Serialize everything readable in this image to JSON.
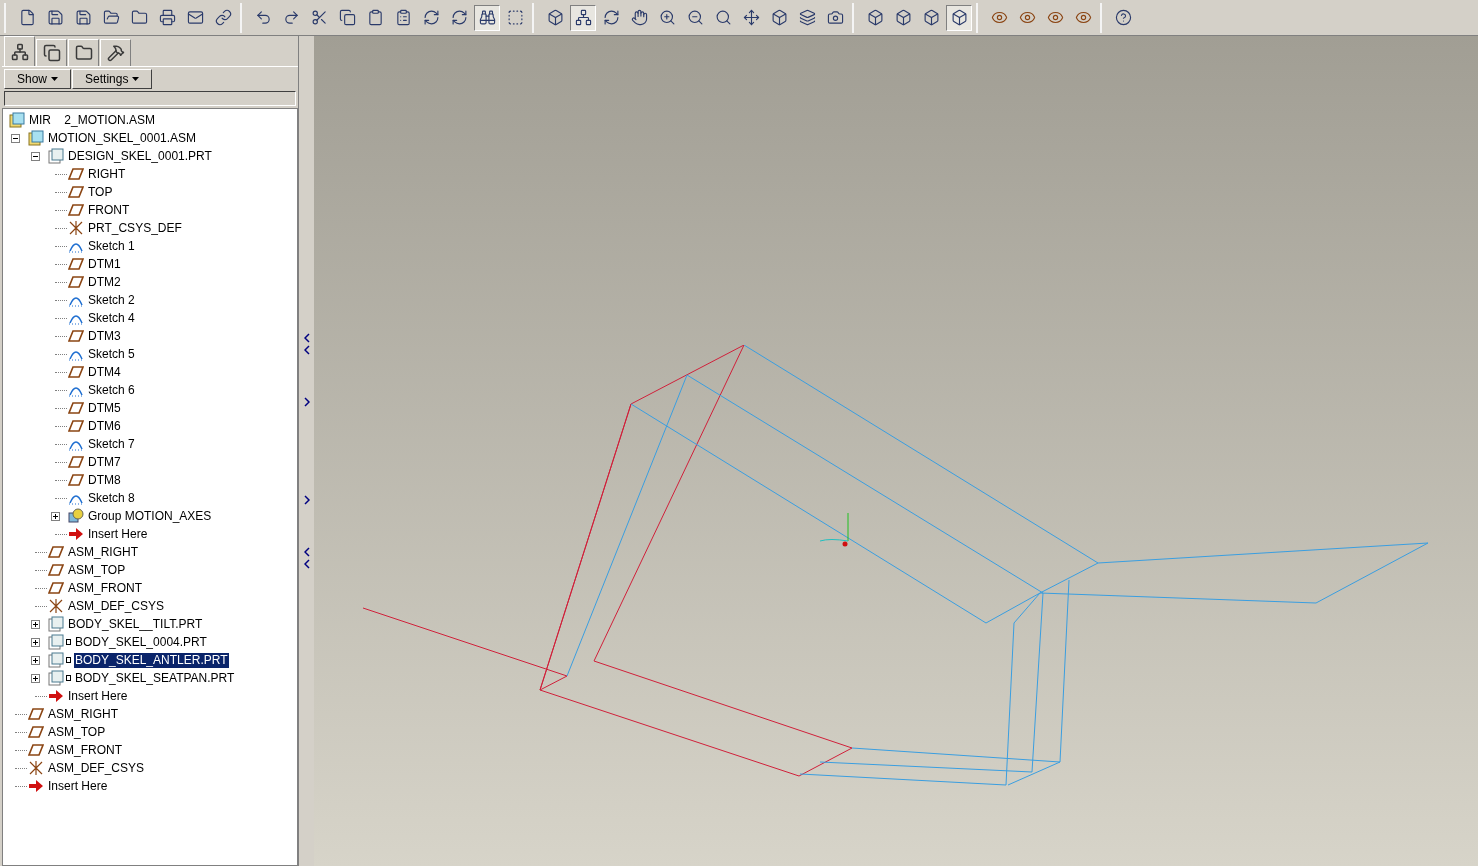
{
  "toolbar": {
    "groups": [
      {
        "buttons": [
          {
            "pressed": false
          },
          {
            "pressed": false
          },
          {
            "pressed": false
          },
          {
            "pressed": false
          },
          {
            "pressed": false
          },
          {
            "pressed": false
          },
          {
            "pressed": false
          },
          {
            "pressed": false
          }
        ]
      },
      {
        "buttons": [
          {
            "pressed": false
          },
          {
            "pressed": false
          },
          {
            "pressed": false
          },
          {
            "pressed": false
          },
          {
            "pressed": false
          },
          {
            "pressed": false
          },
          {
            "pressed": false
          },
          {
            "pressed": false
          },
          {
            "pressed": true
          },
          {
            "pressed": false
          }
        ]
      },
      {
        "buttons": [
          {
            "pressed": false
          },
          {
            "pressed": true
          },
          {
            "pressed": false
          },
          {
            "pressed": false
          },
          {
            "pressed": false
          },
          {
            "pressed": false
          },
          {
            "pressed": false
          },
          {
            "pressed": false
          },
          {
            "pressed": false
          },
          {
            "pressed": false
          },
          {
            "pressed": false
          }
        ]
      },
      {
        "buttons": [
          {
            "pressed": false
          },
          {
            "pressed": false
          },
          {
            "pressed": false
          },
          {
            "pressed": true
          }
        ]
      },
      {
        "buttons": [
          {
            "pressed": false
          },
          {
            "pressed": false
          },
          {
            "pressed": false
          },
          {
            "pressed": false
          }
        ]
      },
      {
        "buttons": [
          {
            "pressed": false
          }
        ]
      }
    ]
  },
  "panel_tabs": [
    {
      "selected": true
    },
    {
      "selected": false
    },
    {
      "selected": false
    },
    {
      "selected": false
    }
  ],
  "panel_menus": [
    "Show",
    "Settings"
  ],
  "tree": [
    {
      "kind": "asm",
      "label": "MIR    2_MOTION.ASM",
      "selected": false,
      "children": [
        {
          "kind": "asm",
          "label": "MOTION_SKEL_0001.ASM",
          "expanded": true,
          "selected": false,
          "children": [
            {
              "kind": "part",
              "label": "DESIGN_SKEL_0001.PRT",
              "expanded": true,
              "selected": false,
              "children": [
                {
                  "kind": "plane",
                  "label": "RIGHT",
                  "selected": false
                },
                {
                  "kind": "plane",
                  "label": "TOP",
                  "selected": false
                },
                {
                  "kind": "plane",
                  "label": "FRONT",
                  "selected": false
                },
                {
                  "kind": "csys",
                  "label": "PRT_CSYS_DEF",
                  "selected": false
                },
                {
                  "kind": "sketch",
                  "label": "Sketch 1",
                  "selected": false
                },
                {
                  "kind": "plane",
                  "label": "DTM1",
                  "selected": false
                },
                {
                  "kind": "plane",
                  "label": "DTM2",
                  "selected": false
                },
                {
                  "kind": "sketch",
                  "label": "Sketch 2",
                  "selected": false
                },
                {
                  "kind": "sketch",
                  "label": "Sketch 4",
                  "selected": false
                },
                {
                  "kind": "plane",
                  "label": "DTM3",
                  "selected": false
                },
                {
                  "kind": "sketch",
                  "label": "Sketch 5",
                  "selected": false
                },
                {
                  "kind": "plane",
                  "label": "DTM4",
                  "selected": false
                },
                {
                  "kind": "sketch",
                  "label": "Sketch 6",
                  "selected": false
                },
                {
                  "kind": "plane",
                  "label": "DTM5",
                  "selected": false
                },
                {
                  "kind": "plane",
                  "label": "DTM6",
                  "selected": false
                },
                {
                  "kind": "sketch",
                  "label": "Sketch 7",
                  "selected": false
                },
                {
                  "kind": "plane",
                  "label": "DTM7",
                  "selected": false
                },
                {
                  "kind": "plane",
                  "label": "DTM8",
                  "selected": false
                },
                {
                  "kind": "sketch",
                  "label": "Sketch 8",
                  "selected": false
                },
                {
                  "kind": "group",
                  "label": "Group MOTION_AXES",
                  "expanded": false,
                  "selected": false
                },
                {
                  "kind": "insert",
                  "label": "Insert Here",
                  "selected": false
                }
              ]
            },
            {
              "kind": "plane",
              "label": "ASM_RIGHT",
              "selected": false
            },
            {
              "kind": "plane",
              "label": "ASM_TOP",
              "selected": false
            },
            {
              "kind": "plane",
              "label": "ASM_FRONT",
              "selected": false
            },
            {
              "kind": "csys",
              "label": "ASM_DEF_CSYS",
              "selected": false
            },
            {
              "kind": "part",
              "label": "BODY_SKEL__TILT.PRT",
              "expanded": false,
              "selected": false
            },
            {
              "kind": "part",
              "label": "BODY_SKEL_0004.PRT",
              "expanded": false,
              "marked": true,
              "selected": false
            },
            {
              "kind": "part",
              "label": "BODY_SKEL_ANTLER.PRT",
              "expanded": false,
              "marked": true,
              "selected": true
            },
            {
              "kind": "part",
              "label": "BODY_SKEL_SEATPAN.PRT",
              "expanded": false,
              "marked": true,
              "selected": false
            },
            {
              "kind": "insert",
              "label": "Insert Here",
              "selected": false
            }
          ]
        },
        {
          "kind": "plane",
          "label": "ASM_RIGHT",
          "selected": false
        },
        {
          "kind": "plane",
          "label": "ASM_TOP",
          "selected": false
        },
        {
          "kind": "plane",
          "label": "ASM_FRONT",
          "selected": false
        },
        {
          "kind": "csys",
          "label": "ASM_DEF_CSYS",
          "selected": false
        },
        {
          "kind": "insert",
          "label": "Insert Here",
          "selected": false
        }
      ]
    }
  ]
}
